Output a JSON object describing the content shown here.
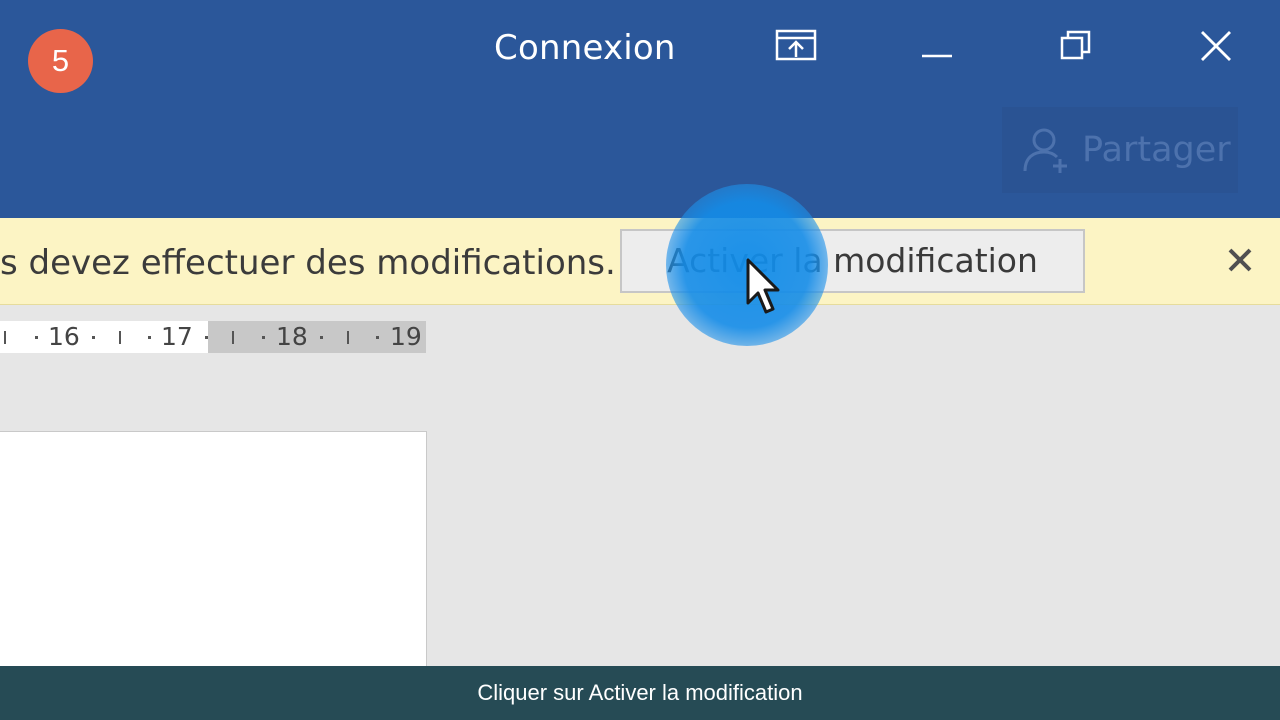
{
  "step": {
    "number": "5"
  },
  "titlebar": {
    "signin_label": "Connexion",
    "icons": [
      "ribbon-display-icon",
      "minimize-icon",
      "restore-icon",
      "close-icon"
    ]
  },
  "ribbon": {
    "share_label": "Partager",
    "share_icon": "add-person-icon"
  },
  "message_bar": {
    "text": "s devez effectuer des modifications.",
    "enable_button_label": "Activer la modification",
    "close_icon": "close-x-icon"
  },
  "ruler": {
    "labels": [
      "16",
      "17",
      "18",
      "19"
    ]
  },
  "caption": {
    "text": "Cliquer sur Activer la modification"
  },
  "colors": {
    "titlebar": "#2b579a",
    "message_bar": "#fcf4c4",
    "step_badge": "#e8654a",
    "caption_bar": "#264b55",
    "highlight": "#118ce8"
  }
}
